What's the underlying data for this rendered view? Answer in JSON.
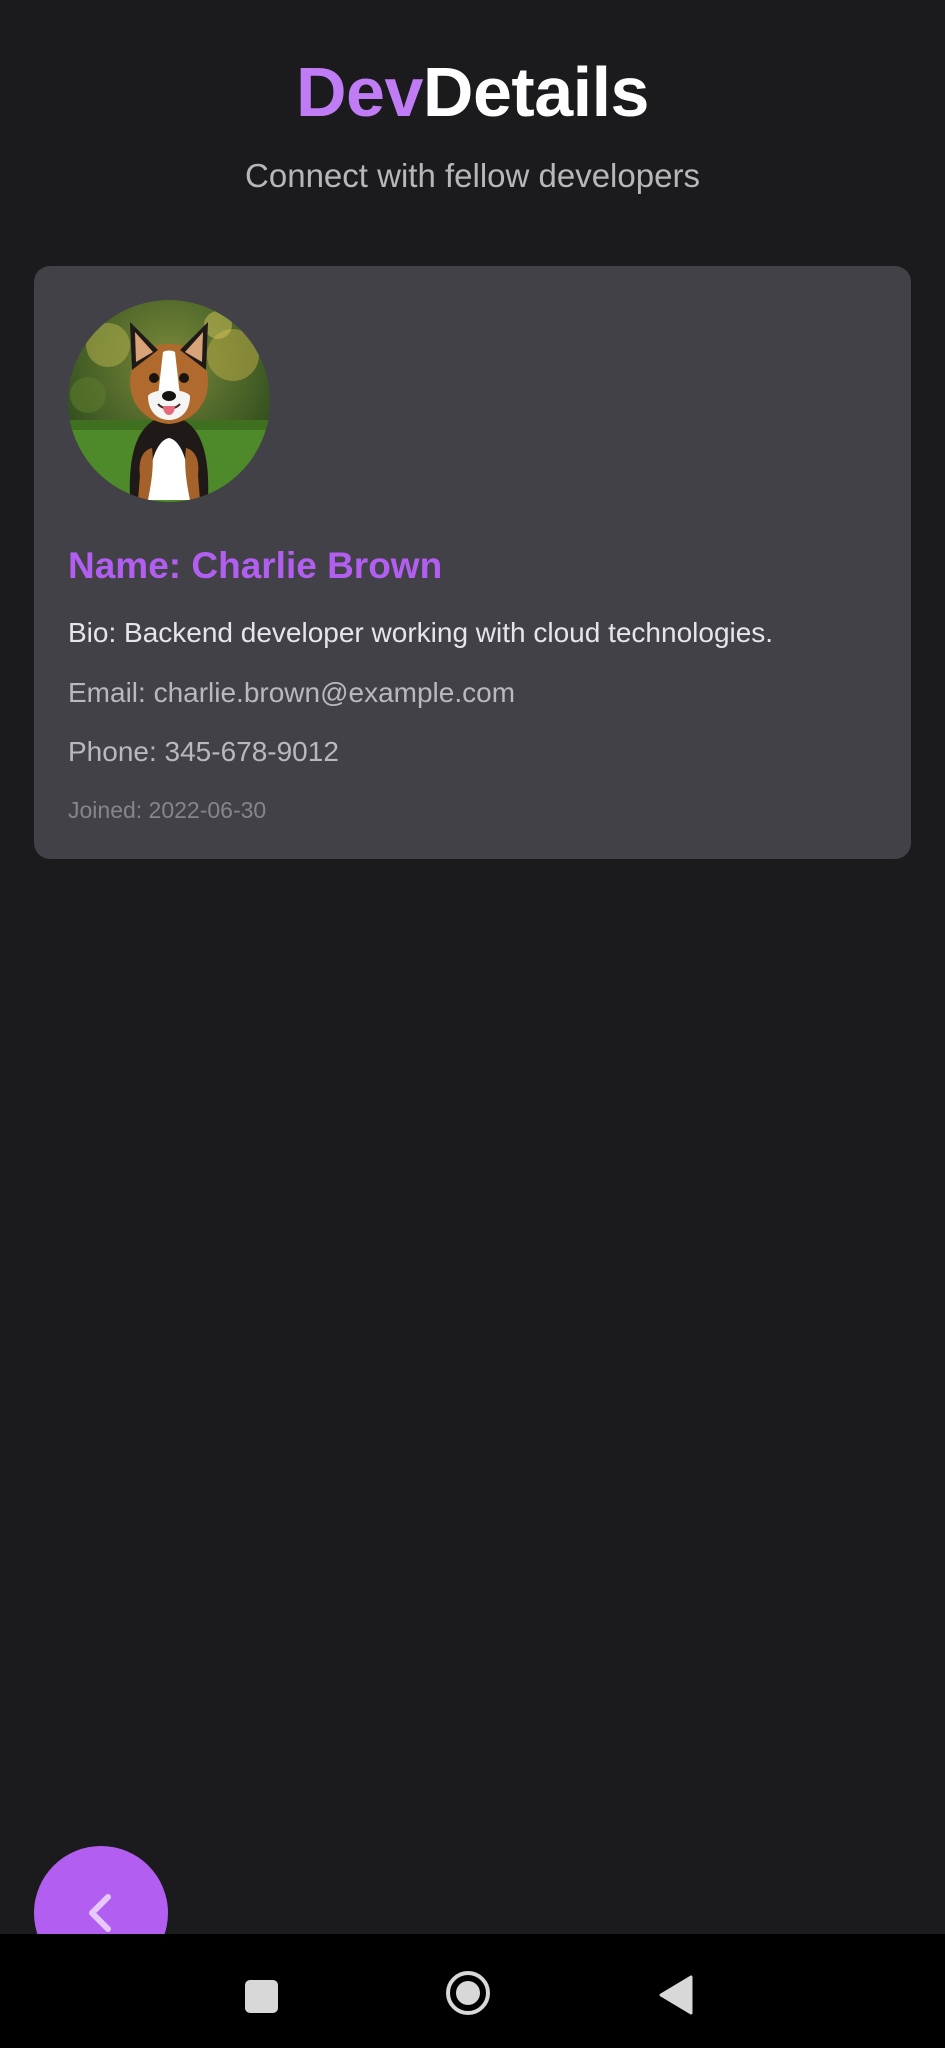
{
  "header": {
    "title_accent": "Dev",
    "title_rest": "Details",
    "subtitle": "Connect with fellow developers"
  },
  "profile": {
    "avatar_icon": "corgi-dog-photo",
    "name": "Name: Charlie Brown",
    "bio": "Bio: Backend developer working with cloud technologies.",
    "email": "Email: charlie.brown@example.com",
    "phone": "Phone: 345-678-9012",
    "joined": "Joined: 2022-06-30"
  },
  "fab": {
    "icon": "chevron-left-icon"
  },
  "system_nav": {
    "recent_icon": "square-icon",
    "home_icon": "circle-icon",
    "back_icon": "triangle-back-icon"
  },
  "colors": {
    "background": "#1b1b1d",
    "card": "#414147",
    "accent": "#b25ef0",
    "title_accent": "#c07cf5"
  }
}
